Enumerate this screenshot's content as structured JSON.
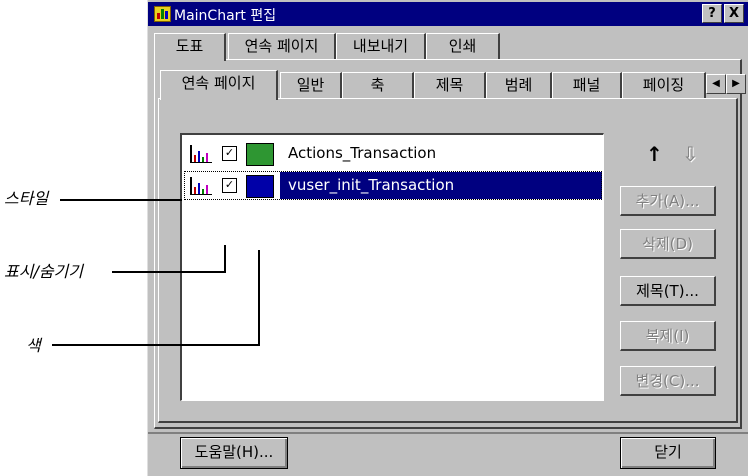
{
  "window": {
    "title": "MainChart 편집",
    "help_btn": "?",
    "close_btn": "X"
  },
  "top_tabs": [
    "도표",
    "연속 페이지",
    "내보내기",
    "인쇄"
  ],
  "sub_tabs": [
    "연속 페이지",
    "일반",
    "축",
    "제목",
    "범례",
    "패널",
    "페이징"
  ],
  "tab_scroll": {
    "left": "◀",
    "right": "▶"
  },
  "list": [
    {
      "label": "Actions_Transaction",
      "checked": true,
      "color": "#2e9632",
      "selected": false
    },
    {
      "label": "vuser_init_Transaction",
      "checked": true,
      "color": "#0000a8",
      "selected": true
    }
  ],
  "arrows": {
    "up": "↑",
    "down": "⇩"
  },
  "buttons": {
    "add": "추가(A)...",
    "delete": "삭제(D)",
    "title": "제목(T)...",
    "copy": "복제(I)",
    "change": "변경(C)..."
  },
  "bottom": {
    "help": "도움말(H)...",
    "close": "닫기"
  },
  "callouts": {
    "style": "스타일",
    "show_hide": "표시/숨기기",
    "color": "색"
  }
}
